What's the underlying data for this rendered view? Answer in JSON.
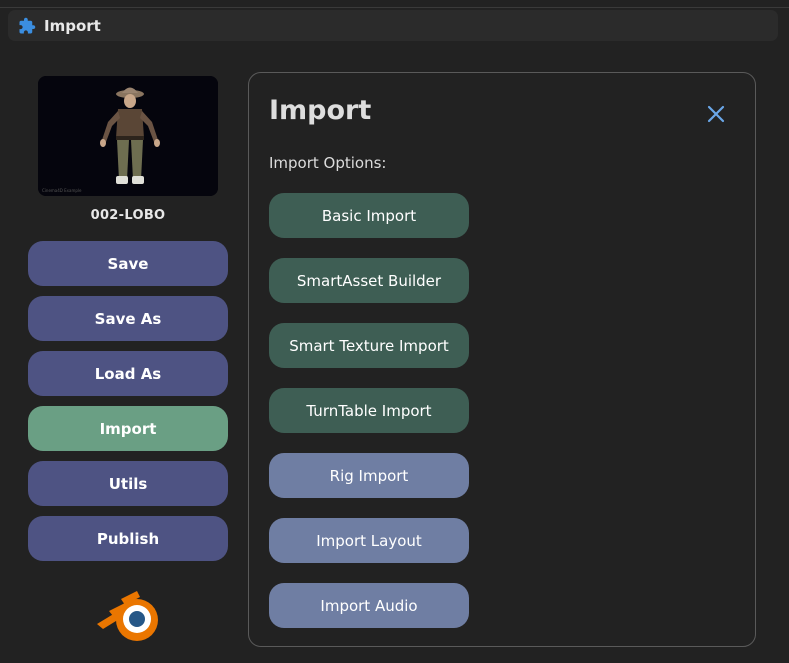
{
  "window": {
    "title": "Import",
    "icon": "puzzle-piece-icon",
    "icon_color": "#3b8ee0"
  },
  "sidebar": {
    "thumbnail_caption": "Cinema4D Example",
    "asset_name": "002-LOBO",
    "buttons": [
      {
        "label": "Save",
        "active": false
      },
      {
        "label": "Save As",
        "active": false
      },
      {
        "label": "Load As",
        "active": false
      },
      {
        "label": "Import",
        "active": true
      },
      {
        "label": "Utils",
        "active": false
      },
      {
        "label": "Publish",
        "active": false
      }
    ],
    "logo": "blender-logo"
  },
  "panel": {
    "title": "Import",
    "close_icon": "close-icon",
    "options_label": "Import Options:",
    "options": [
      {
        "label": "Basic Import",
        "style": "dark"
      },
      {
        "label": "SmartAsset Builder",
        "style": "dark"
      },
      {
        "label": "Smart Texture Import",
        "style": "dark"
      },
      {
        "label": "TurnTable Import",
        "style": "dark"
      },
      {
        "label": "Rig Import",
        "style": "light"
      },
      {
        "label": "Import Layout",
        "style": "light"
      },
      {
        "label": "Import Audio",
        "style": "light"
      }
    ]
  },
  "colors": {
    "background": "#222222",
    "sidebar_button": "#4e5383",
    "active_button": "#6a9f84",
    "option_dark": "#3e5e54",
    "option_light": "#6f7ea3",
    "close_icon": "#6aa7e8"
  }
}
